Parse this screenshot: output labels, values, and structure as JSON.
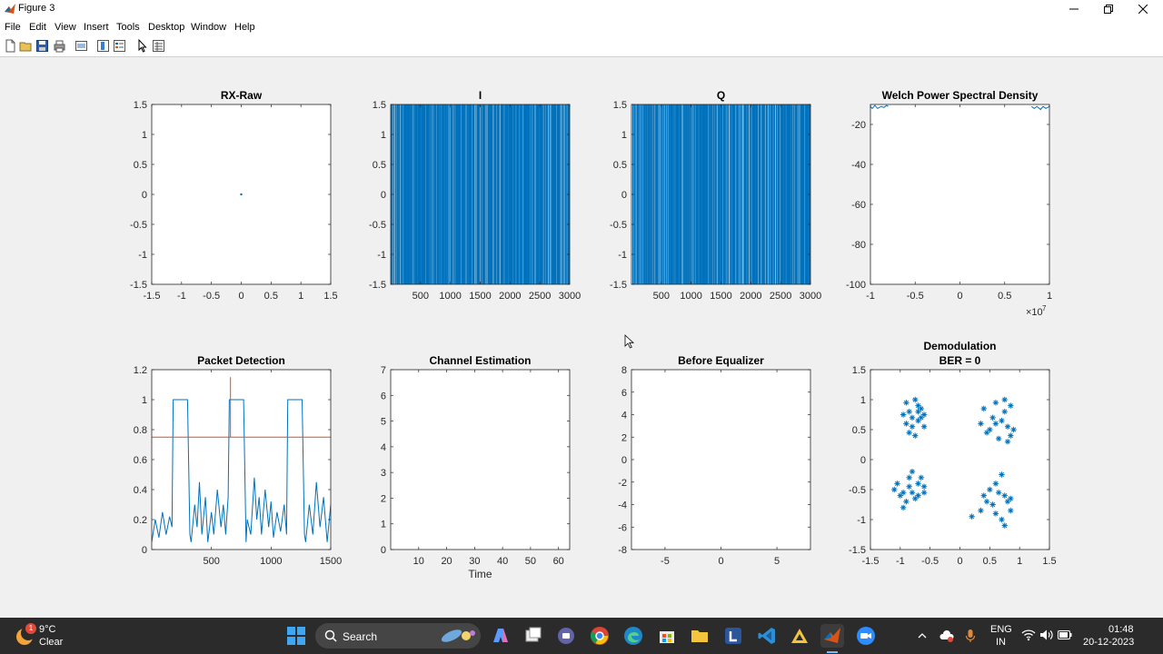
{
  "window": {
    "title": "Figure 3"
  },
  "menu": [
    "File",
    "Edit",
    "View",
    "Insert",
    "Tools",
    "Desktop",
    "Window",
    "Help"
  ],
  "colors": {
    "series1": "#0072bd",
    "series2": "#d95319",
    "axes": "#262626"
  },
  "chart_data": [
    {
      "id": "rx-raw",
      "type": "scatter",
      "title": "RX-Raw",
      "xlim": [
        -1.5,
        1.5
      ],
      "ylim": [
        -1.5,
        1.5
      ],
      "xticks": [
        -1.5,
        -1,
        -0.5,
        0,
        0.5,
        1,
        1.5
      ],
      "yticks": [
        -1.5,
        -1,
        -0.5,
        0,
        0.5,
        1,
        1.5
      ],
      "points": [
        [
          0,
          0
        ]
      ],
      "marker": "dot"
    },
    {
      "id": "i-plot",
      "type": "line",
      "title": "I",
      "xlim": [
        0,
        3000
      ],
      "ylim": [
        -1.5,
        1.5
      ],
      "xticks": [
        500,
        1000,
        1500,
        2000,
        2500,
        3000
      ],
      "yticks": [
        -1.5,
        -1,
        -0.5,
        0,
        0.5,
        1,
        1.5
      ],
      "style": "dense-vertical"
    },
    {
      "id": "q-plot",
      "type": "line",
      "title": "Q",
      "xlim": [
        0,
        3000
      ],
      "ylim": [
        -1.5,
        1.5
      ],
      "xticks": [
        500,
        1000,
        1500,
        2000,
        2500,
        3000
      ],
      "yticks": [
        -1.5,
        -1,
        -0.5,
        0,
        0.5,
        1,
        1.5
      ],
      "style": "dense-vertical"
    },
    {
      "id": "psd",
      "type": "line",
      "title": "Welch Power Spectral Density",
      "xlim": [
        -1,
        1
      ],
      "ylim": [
        -100,
        -10
      ],
      "xticks": [
        -1,
        -0.5,
        0,
        0.5,
        1
      ],
      "yticks": [
        -100,
        -80,
        -60,
        -40,
        -20
      ],
      "xexponent": "7",
      "series": [
        {
          "x": [
            -1,
            -0.98,
            -0.95,
            -0.92,
            -0.88,
            -0.85,
            -0.82,
            -0.8
          ],
          "y": [
            -11,
            -12,
            -10.5,
            -12,
            -11,
            -11.5,
            -10.5,
            -11
          ]
        },
        {
          "x": [
            0.8,
            0.83,
            0.86,
            0.9,
            0.93,
            0.96,
            1
          ],
          "y": [
            -11,
            -12,
            -11,
            -12.5,
            -11,
            -12,
            -11
          ]
        }
      ]
    },
    {
      "id": "packet-detection",
      "type": "line",
      "title": "Packet Detection",
      "xlim": [
        0,
        1500
      ],
      "ylim": [
        0,
        1.2
      ],
      "xticks": [
        500,
        1000,
        1500
      ],
      "yticks": [
        0,
        0.2,
        0.4,
        0.6,
        0.8,
        1,
        1.2
      ],
      "threshold": 0.75,
      "spike": {
        "x": 660,
        "y": 1.15
      },
      "series": [
        {
          "x": [
            0,
            30,
            60,
            90,
            120,
            150,
            170,
            180,
            300,
            320,
            330,
            360,
            380,
            400,
            420,
            450,
            470,
            500,
            520,
            550,
            580,
            600,
            620,
            640,
            650,
            770,
            790,
            800,
            830,
            860,
            880,
            900,
            920,
            950,
            980,
            1000,
            1020,
            1050,
            1080,
            1110,
            1130,
            1140,
            1260,
            1280,
            1290,
            1320,
            1350,
            1380,
            1410,
            1440,
            1470,
            1500
          ],
          "y": [
            0.05,
            0.2,
            0.08,
            0.25,
            0.1,
            0.22,
            0.15,
            1.0,
            1.0,
            0.1,
            0.05,
            0.3,
            0.15,
            0.45,
            0.1,
            0.35,
            0.05,
            0.25,
            0.1,
            0.4,
            0.15,
            0.3,
            0.1,
            0.35,
            1.0,
            1.0,
            0.05,
            0.2,
            0.1,
            0.48,
            0.2,
            0.35,
            0.1,
            0.4,
            0.15,
            0.32,
            0.08,
            0.25,
            0.12,
            0.3,
            0.1,
            1.0,
            1.0,
            0.1,
            0.05,
            0.3,
            0.1,
            0.45,
            0.15,
            0.35,
            0.05,
            0.3
          ]
        }
      ]
    },
    {
      "id": "channel-estimation",
      "type": "line",
      "title": "Channel Estimation",
      "xlabel": "Time",
      "xlim": [
        0,
        64
      ],
      "ylim": [
        0,
        7
      ],
      "xticks": [
        10,
        20,
        30,
        40,
        50,
        60
      ],
      "yticks": [
        0,
        1,
        2,
        3,
        4,
        5,
        6,
        7
      ],
      "series": []
    },
    {
      "id": "before-equalizer",
      "type": "scatter",
      "title": "Before Equalizer",
      "xlim": [
        -8,
        8
      ],
      "ylim": [
        -8,
        8
      ],
      "xticks": [
        -5,
        0,
        5
      ],
      "yticks": [
        -8,
        -6,
        -4,
        -2,
        0,
        2,
        4,
        6,
        8
      ],
      "points": []
    },
    {
      "id": "demodulation",
      "type": "scatter",
      "title": "Demodulation",
      "subtitle": "BER = 0",
      "xlim": [
        -1.5,
        1.5
      ],
      "ylim": [
        -1.5,
        1.5
      ],
      "xticks": [
        -1.5,
        -1,
        -0.5,
        0,
        0.5,
        1,
        1.5
      ],
      "yticks": [
        -1.5,
        -1,
        -0.5,
        0,
        0.5,
        1,
        1.5
      ],
      "marker": "star",
      "points": [
        [
          -0.9,
          0.95
        ],
        [
          -0.75,
          1.0
        ],
        [
          -0.7,
          0.9
        ],
        [
          -0.85,
          0.8
        ],
        [
          -0.65,
          0.85
        ],
        [
          -0.8,
          0.7
        ],
        [
          -0.9,
          0.6
        ],
        [
          -0.7,
          0.65
        ],
        [
          -0.6,
          0.55
        ],
        [
          -0.85,
          0.45
        ],
        [
          -0.75,
          0.4
        ],
        [
          -0.65,
          0.7
        ],
        [
          -0.95,
          0.75
        ],
        [
          -0.7,
          0.8
        ],
        [
          -0.6,
          0.75
        ],
        [
          -0.8,
          0.55
        ],
        [
          0.4,
          0.85
        ],
        [
          0.6,
          0.95
        ],
        [
          0.75,
          1.0
        ],
        [
          0.85,
          0.9
        ],
        [
          0.55,
          0.7
        ],
        [
          0.7,
          0.65
        ],
        [
          0.8,
          0.55
        ],
        [
          0.9,
          0.5
        ],
        [
          0.35,
          0.6
        ],
        [
          0.5,
          0.5
        ],
        [
          0.65,
          0.35
        ],
        [
          0.85,
          0.4
        ],
        [
          0.45,
          0.45
        ],
        [
          0.75,
          0.8
        ],
        [
          0.6,
          0.6
        ],
        [
          0.8,
          0.3
        ],
        [
          -1.1,
          -0.5
        ],
        [
          -0.95,
          -0.55
        ],
        [
          -0.85,
          -0.3
        ],
        [
          -0.8,
          -0.2
        ],
        [
          -0.7,
          -0.4
        ],
        [
          -0.6,
          -0.55
        ],
        [
          -0.75,
          -0.65
        ],
        [
          -0.9,
          -0.7
        ],
        [
          -1.0,
          -0.6
        ],
        [
          -0.65,
          -0.3
        ],
        [
          -0.85,
          -0.45
        ],
        [
          -0.95,
          -0.8
        ],
        [
          -0.7,
          -0.6
        ],
        [
          -0.6,
          -0.45
        ],
        [
          -1.05,
          -0.4
        ],
        [
          -0.8,
          -0.55
        ],
        [
          0.2,
          -0.95
        ],
        [
          0.35,
          -0.85
        ],
        [
          0.45,
          -0.7
        ],
        [
          0.5,
          -0.5
        ],
        [
          0.6,
          -0.4
        ],
        [
          0.7,
          -0.25
        ],
        [
          0.75,
          -0.6
        ],
        [
          0.8,
          -0.7
        ],
        [
          0.85,
          -0.85
        ],
        [
          0.7,
          -1.0
        ],
        [
          0.6,
          -0.9
        ],
        [
          0.55,
          -0.75
        ],
        [
          0.75,
          -1.1
        ],
        [
          0.65,
          -0.55
        ],
        [
          0.4,
          -0.6
        ],
        [
          0.85,
          -0.65
        ]
      ]
    }
  ],
  "taskbar": {
    "weather_temp": "9°C",
    "weather_desc": "Clear",
    "weather_badge": "1",
    "search_label": "Search",
    "lang": "ENG",
    "region": "IN",
    "time": "01:48",
    "date": "20-12-2023"
  }
}
